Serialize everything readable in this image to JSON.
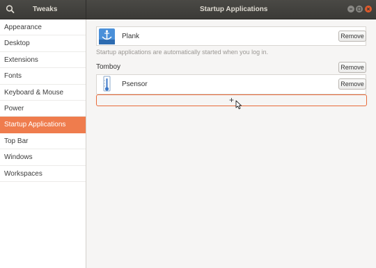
{
  "header": {
    "app_title": "Tweaks",
    "page_title": "Startup Applications"
  },
  "sidebar": {
    "items": [
      {
        "label": "Appearance"
      },
      {
        "label": "Desktop"
      },
      {
        "label": "Extensions"
      },
      {
        "label": "Fonts"
      },
      {
        "label": "Keyboard & Mouse"
      },
      {
        "label": "Power"
      },
      {
        "label": "Startup Applications",
        "active": true
      },
      {
        "label": "Top Bar"
      },
      {
        "label": "Windows"
      },
      {
        "label": "Workspaces"
      }
    ]
  },
  "main": {
    "apps": [
      {
        "name": "Plank",
        "icon": "plank-icon",
        "remove_label": "Remove"
      },
      {
        "name": "Tomboy",
        "icon": "none",
        "remove_label": "Remove"
      },
      {
        "name": "Psensor",
        "icon": "thermometer-icon",
        "remove_label": "Remove"
      }
    ],
    "hint": "Startup applications are automatically started when you log in.",
    "add_label": "+"
  },
  "colors": {
    "accent": "#ef7c4d",
    "headerbar": "#3f3e3b",
    "close_button": "#e05a2b"
  }
}
